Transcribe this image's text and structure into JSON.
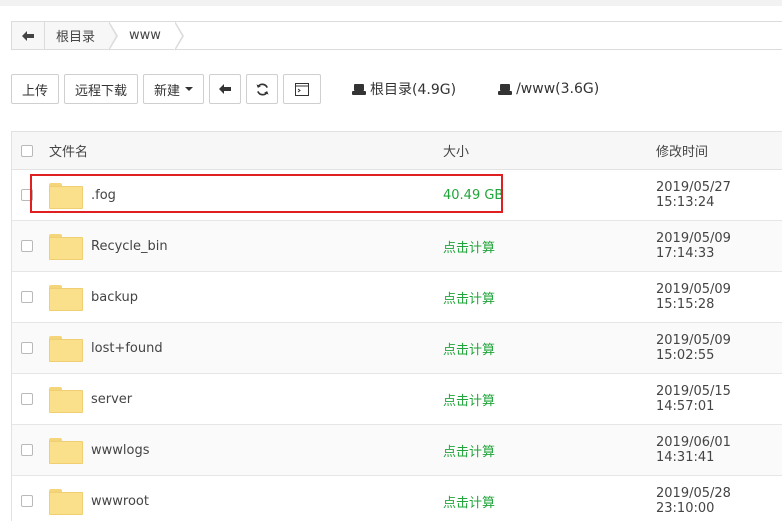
{
  "breadcrumb": {
    "items": [
      {
        "label": "根目录"
      },
      {
        "label": "www"
      }
    ]
  },
  "toolbar": {
    "upload_label": "上传",
    "remote_download_label": "远程下载",
    "new_label": "新建",
    "disks": [
      {
        "label": "根目录(4.9G)"
      },
      {
        "label": "/www(3.6G)"
      }
    ]
  },
  "table": {
    "columns": {
      "name": "文件名",
      "size": "大小",
      "modified": "修改时间"
    },
    "rows": [
      {
        "name": ".fog",
        "size": "40.49 GB",
        "modified": "2019/05/27 15:13:24"
      },
      {
        "name": "Recycle_bin",
        "size": "点击计算",
        "modified": "2019/05/09 17:14:33"
      },
      {
        "name": "backup",
        "size": "点击计算",
        "modified": "2019/05/09 15:15:28"
      },
      {
        "name": "lost+found",
        "size": "点击计算",
        "modified": "2019/05/09 15:02:55"
      },
      {
        "name": "server",
        "size": "点击计算",
        "modified": "2019/05/15 14:57:01"
      },
      {
        "name": "wwwlogs",
        "size": "点击计算",
        "modified": "2019/06/01 14:31:41"
      },
      {
        "name": "wwwroot",
        "size": "点击计算",
        "modified": "2019/05/28 23:10:00"
      }
    ]
  },
  "colors": {
    "size_link": "#20a53a",
    "highlight": "#e02020",
    "folder": "#fbe08b"
  }
}
